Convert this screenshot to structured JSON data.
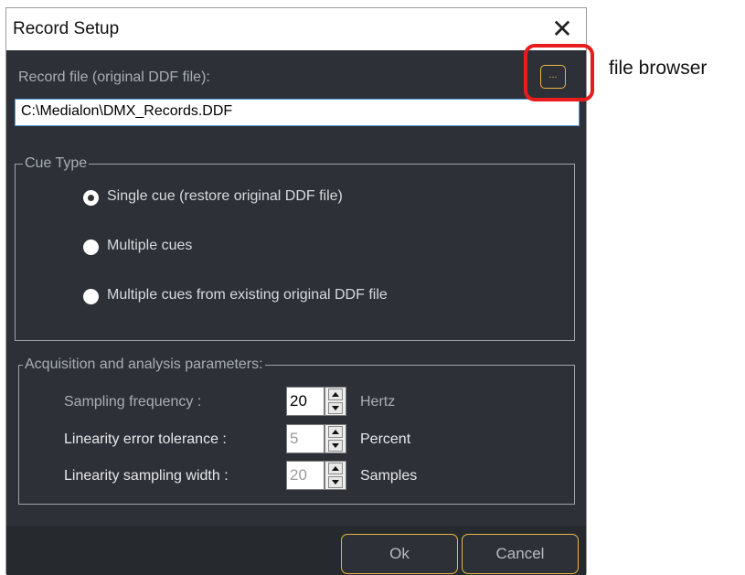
{
  "window": {
    "title": "Record Setup",
    "close_glyph": "✕"
  },
  "record_file": {
    "label": "Record file (original DDF file):",
    "value": "C:\\Medialon\\DMX_Records.DDF",
    "browse_label": "..."
  },
  "cue_type": {
    "legend": "Cue Type",
    "options": [
      {
        "label": "Single cue (restore original DDF file)",
        "checked": true
      },
      {
        "label": "Multiple cues",
        "checked": false
      },
      {
        "label": "Multiple cues from existing original DDF file",
        "checked": false
      }
    ]
  },
  "acquisition": {
    "legend": "Acquisition and analysis parameters:",
    "params": [
      {
        "label": "Sampling frequency :",
        "value": "20",
        "unit": "Hertz",
        "enabled": true
      },
      {
        "label": "Linearity error tolerance :",
        "value": "5",
        "unit": "Percent",
        "enabled": false
      },
      {
        "label": "Linearity sampling width :",
        "value": "20",
        "unit": "Samples",
        "enabled": false
      }
    ]
  },
  "buttons": {
    "ok": "Ok",
    "cancel": "Cancel"
  },
  "annotation": {
    "text": "file browser"
  },
  "colors": {
    "dialog_bg": "#2d3137",
    "accent": "#e8b545",
    "highlight": "#e81c1c"
  },
  "icons": {
    "close": "close-icon",
    "spin_up": "spin-up-icon",
    "spin_down": "spin-down-icon"
  }
}
